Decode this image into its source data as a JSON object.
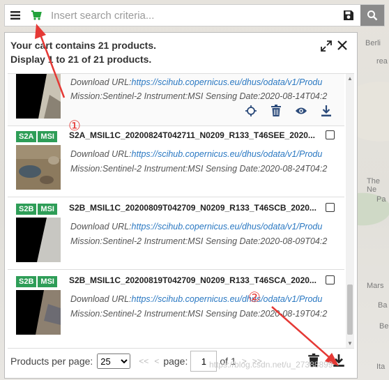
{
  "search": {
    "placeholder": "Insert search criteria..."
  },
  "cart": {
    "summary_line1": "Your cart contains 21 products.",
    "summary_line2": "Display 1 to 21 of 21 products."
  },
  "items": [
    {
      "platform": "",
      "instrument": "",
      "name": "",
      "url_label": "Download URL:",
      "url": "https://scihub.copernicus.eu/dhus/odata/v1/Produ",
      "mission_label": "Mission:",
      "mission": "Sentinel-2",
      "instrument_label": " Instrument:",
      "instrument_value": "MSI",
      "date_label": " Sensing Date:",
      "date": "2020-08-14T04:2"
    },
    {
      "platform": "S2A",
      "instrument": "MSI",
      "name": "S2A_MSIL1C_20200824T042711_N0209_R133_T46SEE_2020...",
      "url_label": "Download URL:",
      "url": "https://scihub.copernicus.eu/dhus/odata/v1/Produ",
      "mission_label": "Mission:",
      "mission": "Sentinel-2",
      "instrument_label": " Instrument:",
      "instrument_value": "MSI",
      "date_label": " Sensing Date:",
      "date": "2020-08-24T04:2"
    },
    {
      "platform": "S2B",
      "instrument": "MSI",
      "name": "S2B_MSIL1C_20200809T042709_N0209_R133_T46SCB_2020...",
      "url_label": "Download URL:",
      "url": "https://scihub.copernicus.eu/dhus/odata/v1/Produ",
      "mission_label": "Mission:",
      "mission": "Sentinel-2",
      "instrument_label": " Instrument:",
      "instrument_value": "MSI",
      "date_label": " Sensing Date:",
      "date": "2020-08-09T04:2"
    },
    {
      "platform": "S2B",
      "instrument": "MSI",
      "name": "S2B_MSIL1C_20200819T042709_N0209_R133_T46SCA_2020...",
      "url_label": "Download URL:",
      "url": "https://scihub.copernicus.eu/dhus/odata/v1/Produ",
      "mission_label": "Mission:",
      "mission": "Sentinel-2",
      "instrument_label": " Instrument:",
      "instrument_value": "MSI",
      "date_label": " Sensing Date:",
      "date": "2020-08-19T04:2"
    }
  ],
  "footer": {
    "per_page_label": "Products per page:",
    "per_page_value": "25",
    "first": "<<",
    "prev": "<",
    "page_label": "page:",
    "page_value": "1",
    "of_label": "of 1",
    "next": ">",
    "last": ">>"
  },
  "annotations": {
    "one": "①",
    "two": "②"
  },
  "map_labels": [
    "Berli",
    "rea",
    "The Ne",
    "Pa",
    "Mars",
    "Ba",
    "Be",
    "Ita"
  ],
  "watermark": "https://blog.csdn.net/u_27388899",
  "colors": {
    "badge": "#2e9d57",
    "link": "#2a78c2",
    "annotation": "#e53935",
    "cart_icon": "#22a33a"
  },
  "icons": [
    "menu-icon",
    "cart-icon",
    "save-icon",
    "search-icon",
    "expand-icon",
    "close-icon",
    "crosshair-icon",
    "trash-icon",
    "eye-icon",
    "download-icon",
    "checkbox-icon"
  ]
}
